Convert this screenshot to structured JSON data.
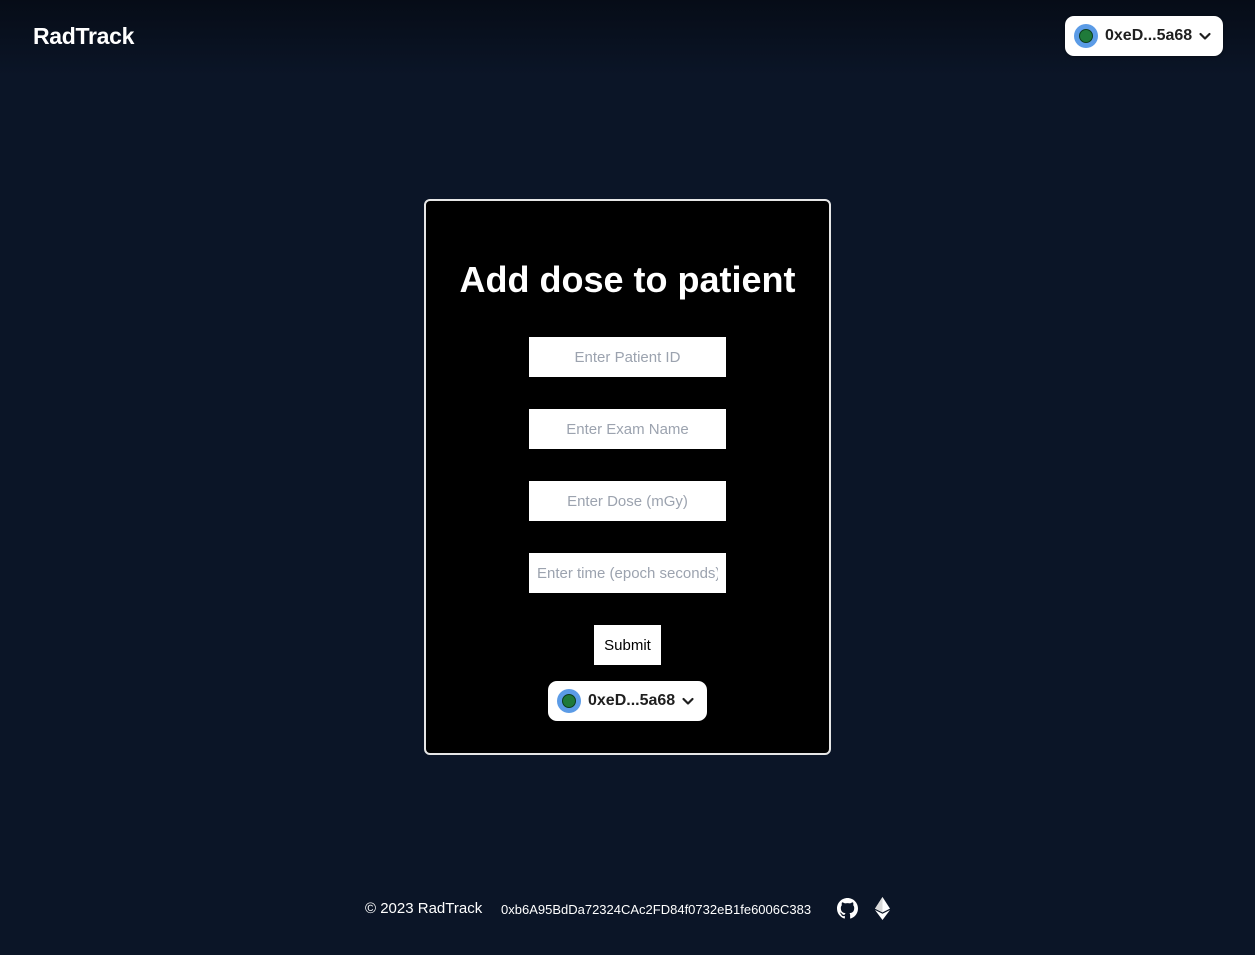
{
  "header": {
    "brand": "RadTrack",
    "wallet": {
      "address": "0xeD...5a68",
      "avatar_icon": "globe-avatar-icon",
      "dropdown_icon": "chevron-down-icon"
    }
  },
  "form": {
    "title": "Add dose to patient",
    "fields": [
      {
        "placeholder": "Enter Patient ID",
        "value": ""
      },
      {
        "placeholder": "Enter Exam Name",
        "value": ""
      },
      {
        "placeholder": "Enter Dose (mGy)",
        "value": ""
      },
      {
        "placeholder": "Enter time (epoch seconds)",
        "value": ""
      }
    ],
    "submit_label": "Submit",
    "wallet": {
      "address": "0xeD...5a68"
    }
  },
  "footer": {
    "copyright": "© 2023 RadTrack",
    "contract_address": "0xb6A95BdDa72324CAc2FD84f0732eB1fe6006C383",
    "icons": [
      "github-icon",
      "ethereum-icon"
    ]
  },
  "colors": {
    "background": "#0b1527",
    "card": "#000000",
    "card_border": "#e6e6e6",
    "avatar": "#5b9be6"
  }
}
